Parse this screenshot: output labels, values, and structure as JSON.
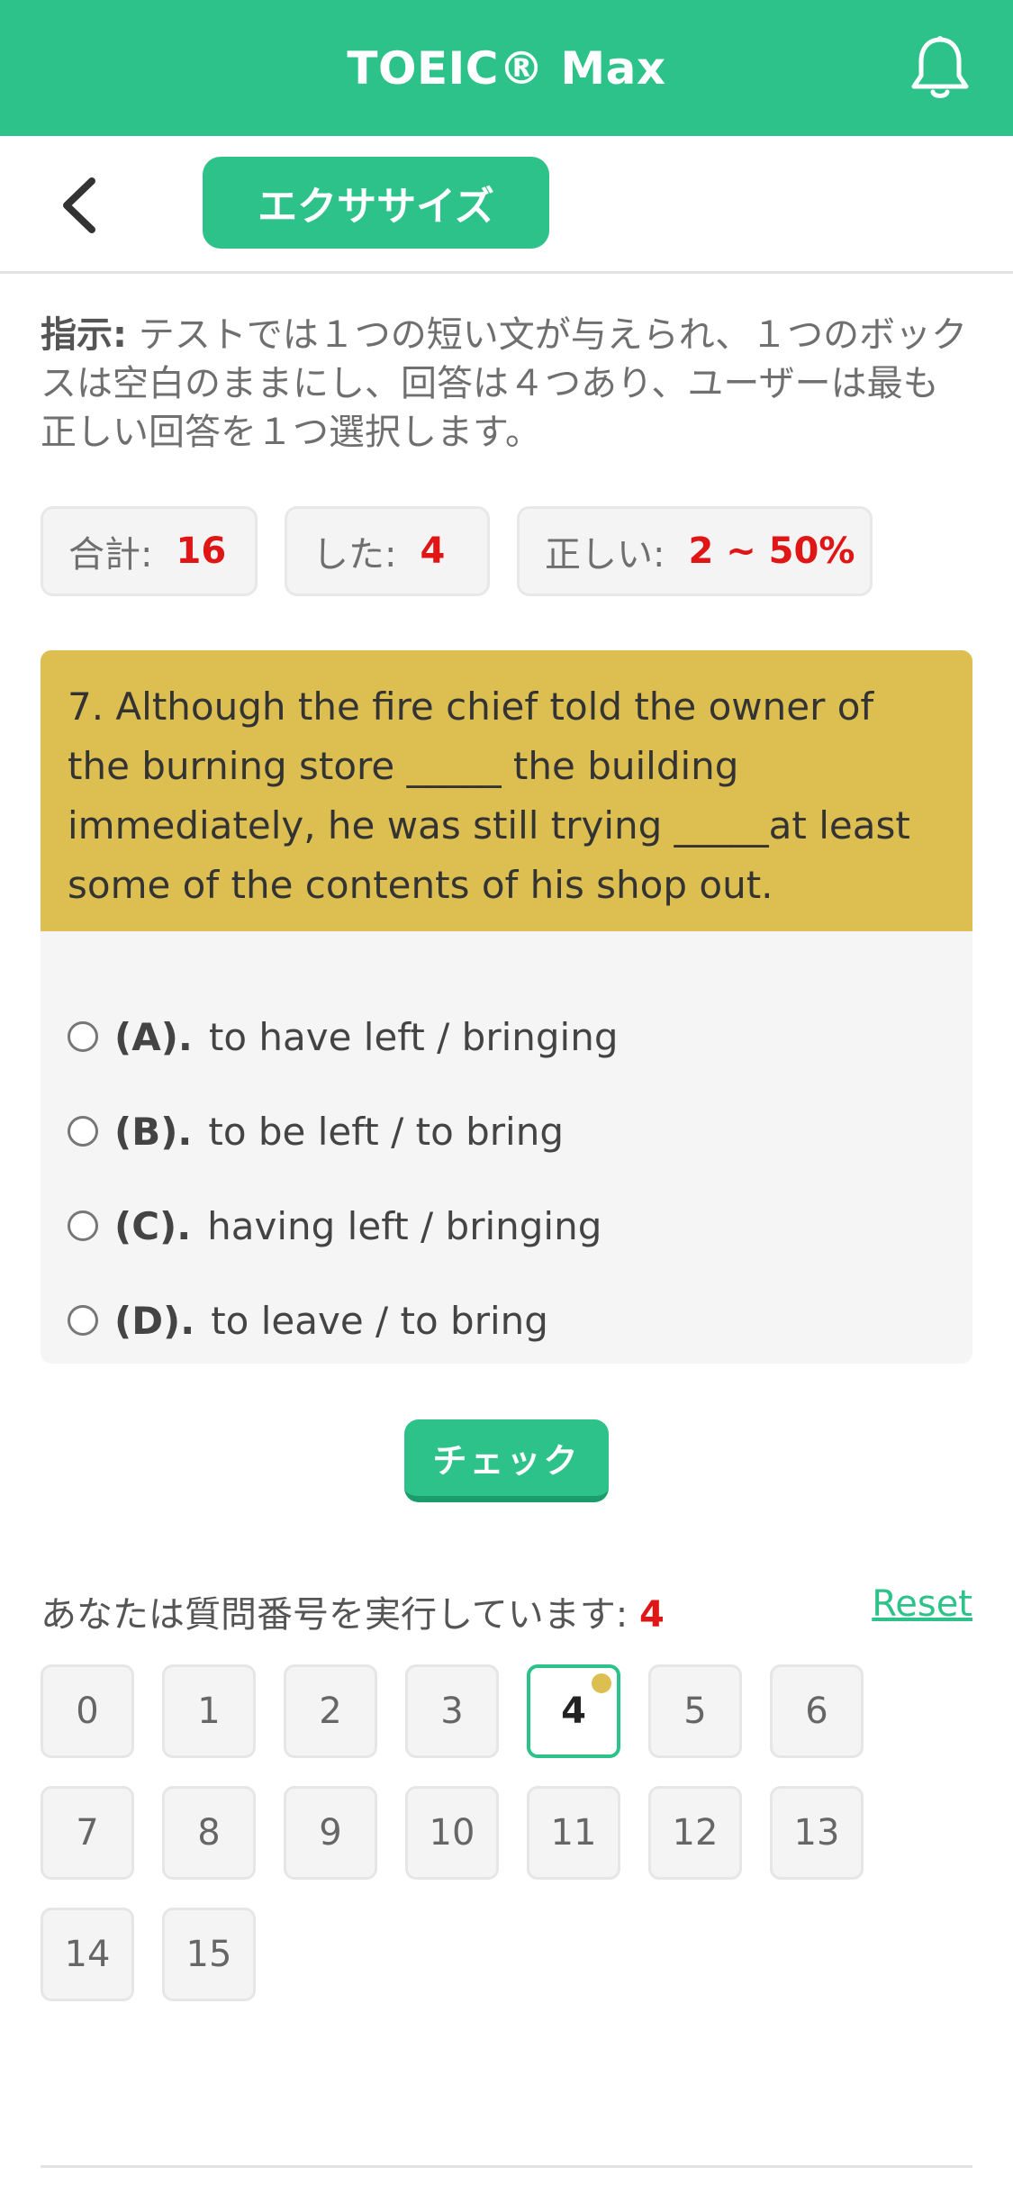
{
  "header": {
    "title": "TOEIC® Max",
    "icon": "bell-icon"
  },
  "subbar": {
    "back_icon": "chevron-left-icon",
    "exercise_label": "エクササイズ"
  },
  "instruction": {
    "label": "指示:",
    "text": " テストでは１つの短い文が与えられ、１つのボックスは空白のままにし、回答は４つあり、ユーザーは最も正しい回答を１つ選択します。"
  },
  "stats": [
    {
      "label": "合計:",
      "value": "16"
    },
    {
      "label": "した:",
      "value": "4"
    },
    {
      "label": "正しい:",
      "value": "2 ~ 50%"
    }
  ],
  "question": {
    "text": "7. Although the fire chief told the owner of the burning store _____ the building immediately, he was still trying _____at least some of the contents of his shop out."
  },
  "options": [
    {
      "key": "(A).",
      "text": "to have left / bringing"
    },
    {
      "key": "(B).",
      "text": "to be left / to bring"
    },
    {
      "key": "(C).",
      "text": "having left / bringing"
    },
    {
      "key": "(D).",
      "text": "to leave / to bring"
    }
  ],
  "check_label": "チェック",
  "progress": {
    "label": "あなたは質問番号を実行しています: ",
    "current": "4",
    "reset_label": "Reset"
  },
  "question_numbers": [
    "0",
    "1",
    "2",
    "3",
    "4",
    "5",
    "6",
    "7",
    "8",
    "9",
    "10",
    "11",
    "12",
    "13",
    "14",
    "15"
  ],
  "active_index": 4,
  "colors": {
    "brand": "#2dc28a",
    "question_bg": "#dcbf50",
    "accent_red": "#e01515"
  }
}
